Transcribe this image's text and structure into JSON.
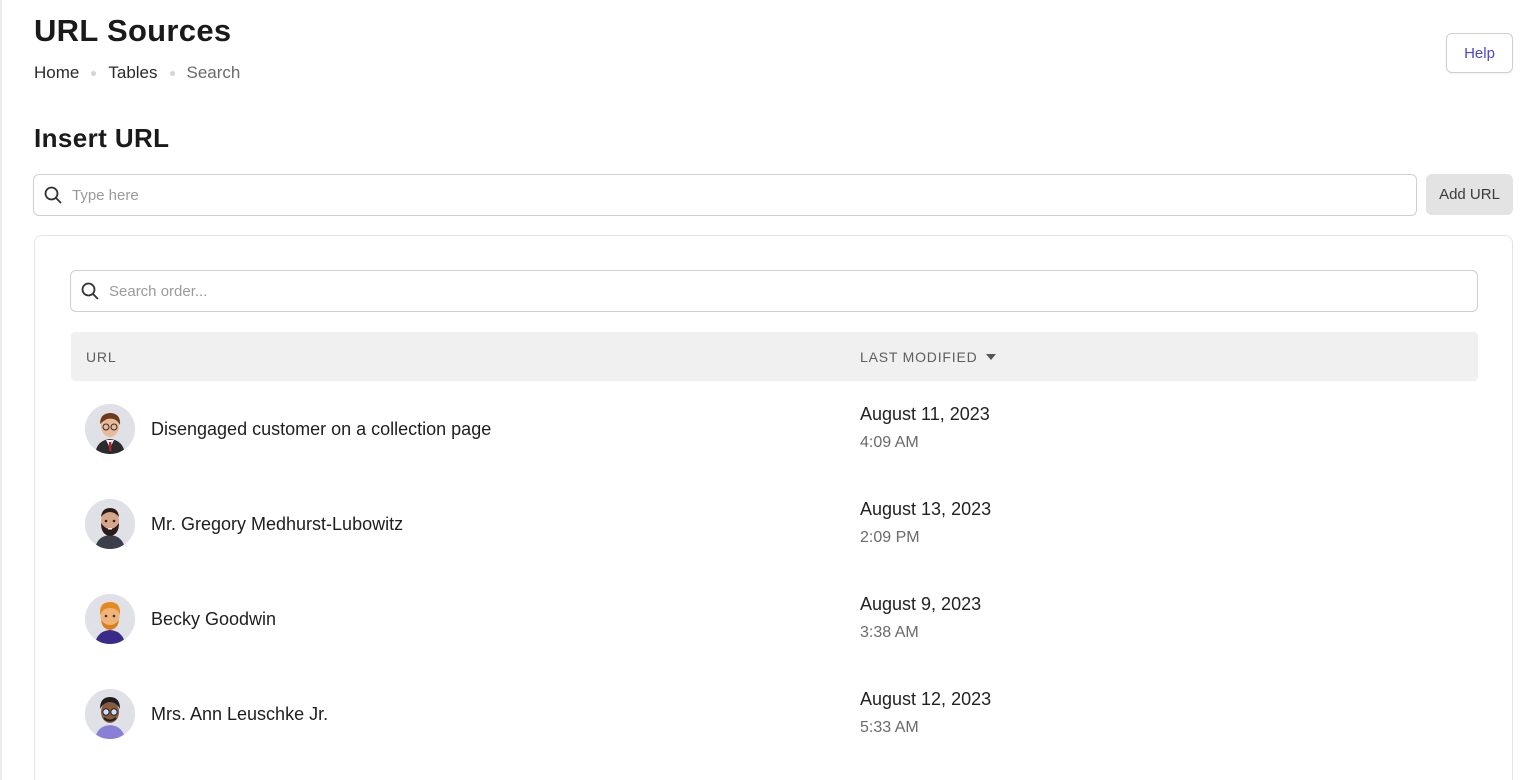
{
  "header": {
    "title": "URL Sources",
    "breadcrumb": [
      "Home",
      "Tables",
      "Search"
    ],
    "help_label": "Help"
  },
  "insert": {
    "title": "Insert URL",
    "placeholder": "Type here",
    "value": "",
    "add_label": "Add URL"
  },
  "table": {
    "search_placeholder": "Search order...",
    "columns": {
      "url": "URL",
      "modified": "LAST MODIFIED"
    },
    "sort": "desc",
    "rows": [
      {
        "name": "Disengaged customer on a collection page",
        "date": "August 11, 2023",
        "time": "4:09 AM",
        "avatar": "avatar-suit-brown-hair"
      },
      {
        "name": "Mr. Gregory Medhurst-Lubowitz",
        "date": "August 13, 2023",
        "time": "2:09 PM",
        "avatar": "avatar-beard-dark"
      },
      {
        "name": "Becky Goodwin",
        "date": "August 9, 2023",
        "time": "3:38 AM",
        "avatar": "avatar-orange-hair"
      },
      {
        "name": "Mrs. Ann Leuschke Jr.",
        "date": "August 12, 2023",
        "time": "5:33 AM",
        "avatar": "avatar-glasses-purple"
      }
    ]
  },
  "colors": {
    "accent": "#4a47c9",
    "table_header_bg": "#f0f0f0",
    "button_bg": "#e3e3e3"
  }
}
